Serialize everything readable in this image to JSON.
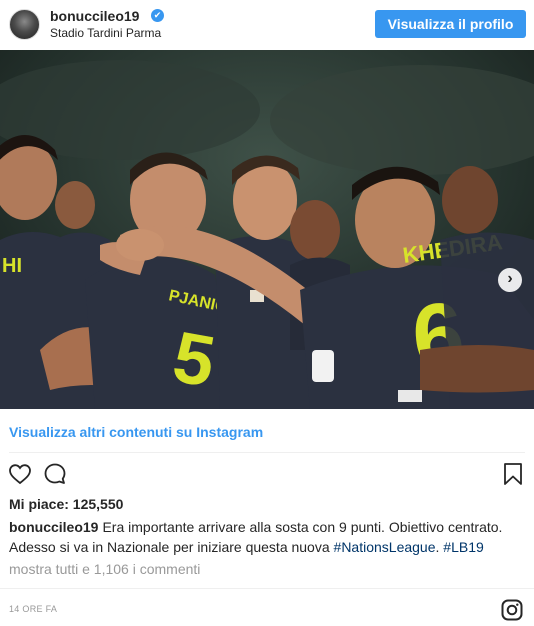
{
  "header": {
    "username": "bonucci leo19",
    "username_display": "bonuccileo19",
    "location": "Stadio Tardini Parma",
    "verified_glyph": "✔",
    "profile_button": "Visualizza il profilo"
  },
  "photo": {
    "players": [
      {
        "name_text": "HI",
        "number": "",
        "jersey_label": "left-player"
      },
      {
        "name_text": "PJANIC",
        "number": "5"
      },
      {
        "name_text": "KHEDIRA",
        "number": "6"
      }
    ],
    "next_arrow": "›"
  },
  "more_link": "Visualizza altri contenuti su Instagram",
  "likes": "Mi piace: 125,550",
  "caption": {
    "user": "bonuccileo19",
    "text_1": "Era importante arrivare alla sosta con 9 punti. Obiettivo centrato. Adesso si va in Nazionale per iniziare questa nuova ",
    "hashtag_1": "#NationsLeague",
    "text_2": ". ",
    "hashtag_2": "#LB19"
  },
  "comments_link": "mostra tutti e 1,106 i commenti",
  "timestamp": "14 ORE FA",
  "icons": {
    "like": "heart-icon",
    "comment": "comment-icon",
    "save": "bookmark-icon",
    "brand": "instagram-icon"
  },
  "colors": {
    "accent": "#3897f0",
    "text": "#262626",
    "muted": "#999999",
    "hashtag": "#003569",
    "jersey": "#2b3140",
    "jersey_text": "#d7e32a"
  }
}
